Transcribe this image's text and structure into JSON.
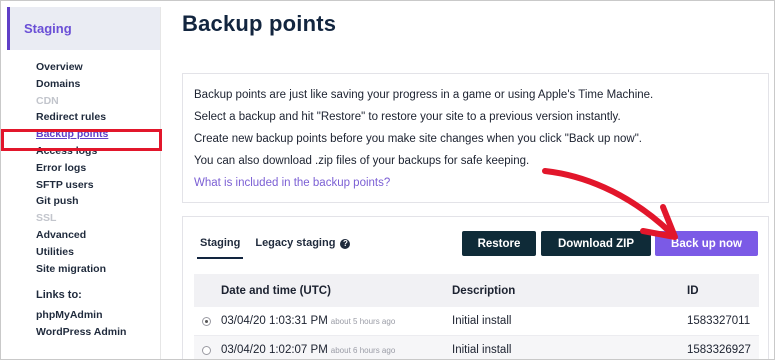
{
  "sidebar": {
    "header": "Staging",
    "items": [
      {
        "label": "Overview",
        "state": "normal"
      },
      {
        "label": "Domains",
        "state": "normal"
      },
      {
        "label": "CDN",
        "state": "disabled"
      },
      {
        "label": "Redirect rules",
        "state": "normal"
      },
      {
        "label": "Backup points",
        "state": "active"
      },
      {
        "label": "Access logs",
        "state": "normal"
      },
      {
        "label": "Error logs",
        "state": "normal"
      },
      {
        "label": "SFTP users",
        "state": "normal"
      },
      {
        "label": "Git push",
        "state": "normal"
      },
      {
        "label": "SSL",
        "state": "disabled"
      },
      {
        "label": "Advanced",
        "state": "normal"
      },
      {
        "label": "Utilities",
        "state": "normal"
      },
      {
        "label": "Site migration",
        "state": "normal"
      }
    ],
    "links_heading": "Links to:",
    "links": [
      "phpMyAdmin",
      "WordPress Admin"
    ]
  },
  "page": {
    "title": "Backup points"
  },
  "info": {
    "lines": [
      "Backup points are just like saving your progress in a game or using Apple's Time Machine.",
      "Select a backup and hit \"Restore\" to restore your site to a previous version instantly.",
      "Create new backup points before you make site changes when you click \"Back up now\".",
      "You can also download .zip files of your backups for safe keeping."
    ],
    "link": "What is included in the backup points?"
  },
  "tabs": [
    {
      "label": "Staging",
      "active": true
    },
    {
      "label": "Legacy staging",
      "active": false
    }
  ],
  "buttons": {
    "restore": "Restore",
    "download": "Download ZIP",
    "backup": "Back up now"
  },
  "table": {
    "headers": [
      "Date and time (UTC)",
      "Description",
      "ID"
    ],
    "rows": [
      {
        "date": "03/04/20 1:03:31 PM",
        "ago": "about 5 hours ago",
        "description": "Initial install",
        "id": "1583327011",
        "selected": true
      },
      {
        "date": "03/04/20 1:02:07 PM",
        "ago": "about 6 hours ago",
        "description": "Initial install",
        "id": "1583326927",
        "selected": false
      }
    ]
  },
  "colors": {
    "accent": "#7b5ae6",
    "dark_button": "#0f2b38",
    "annotation_red": "#e2162b"
  }
}
